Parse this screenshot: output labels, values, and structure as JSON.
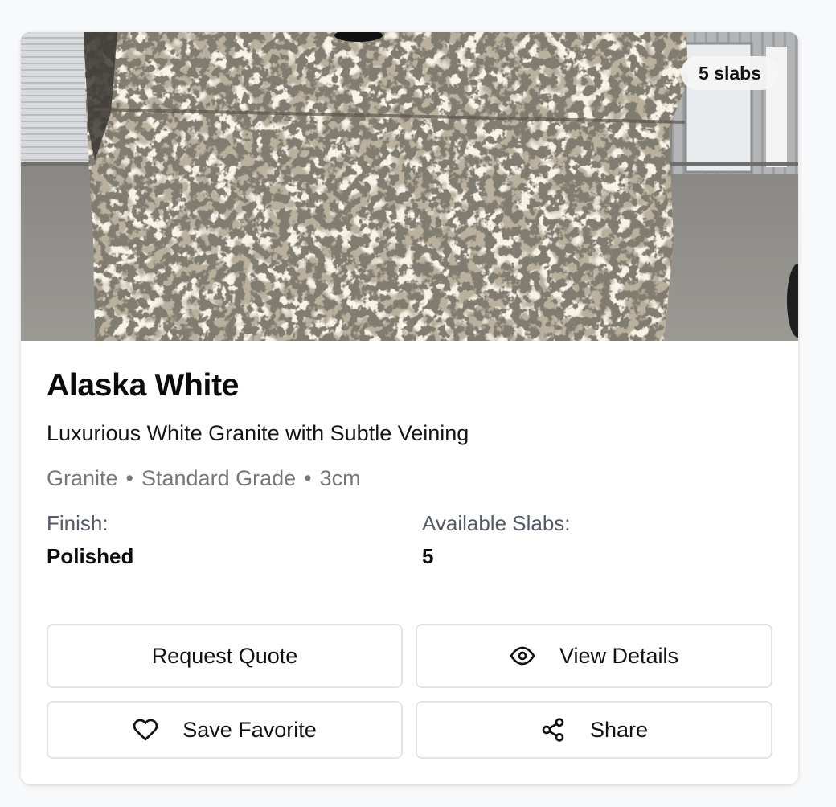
{
  "product": {
    "image_alt": "Alaska White granite slab",
    "slab_badge": "5 slabs",
    "name": "Alaska White",
    "tagline": "Luxurious White Granite with Subtle Veining",
    "material": "Granite",
    "grade": "Standard Grade",
    "thickness": "3cm",
    "separator": "•",
    "finish_label": "Finish:",
    "finish_value": "Polished",
    "slabs_label": "Available Slabs:",
    "slabs_value": "5"
  },
  "actions": {
    "request_quote": "Request Quote",
    "view_details": "View Details",
    "save_favorite": "Save Favorite",
    "share": "Share"
  },
  "icons": {
    "view_details": "eye-icon",
    "save_favorite": "heart-icon",
    "share": "share-icon"
  }
}
